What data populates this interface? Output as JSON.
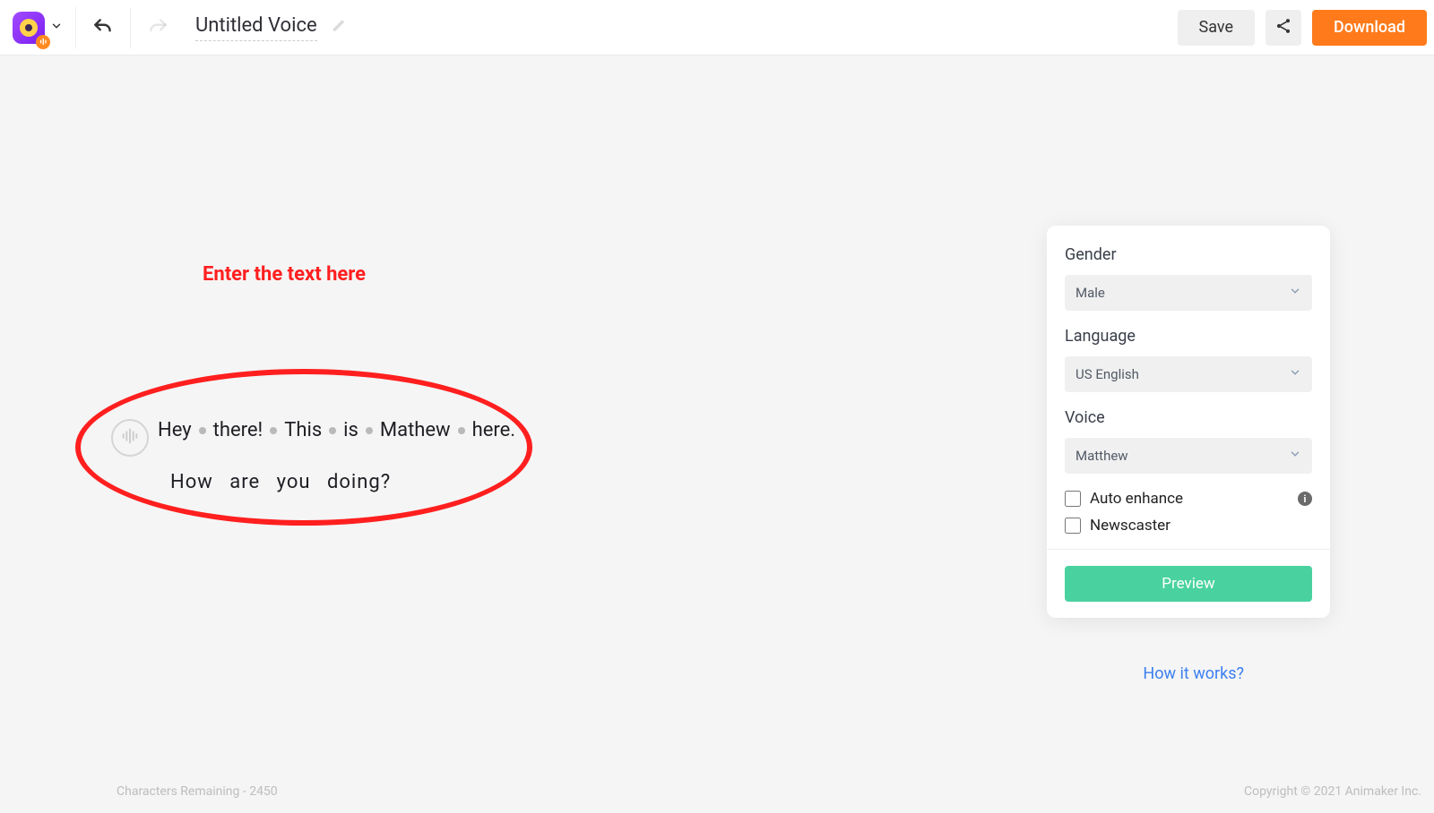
{
  "header": {
    "title": "Untitled Voice",
    "save_label": "Save",
    "download_label": "Download"
  },
  "annotation": {
    "label": "Enter the text here"
  },
  "editor": {
    "line1_tokens": [
      "Hey",
      "there!",
      "This",
      "is",
      "Mathew",
      "here."
    ],
    "line2": "How  are  you  doing?"
  },
  "panel": {
    "gender_label": "Gender",
    "gender_value": "Male",
    "language_label": "Language",
    "language_value": "US English",
    "voice_label": "Voice",
    "voice_value": "Matthew",
    "auto_enhance_label": "Auto enhance",
    "newscaster_label": "Newscaster",
    "preview_label": "Preview"
  },
  "how_it_works": "How it works?",
  "footer": {
    "chars_remaining_label": "Characters Remaining - 2450",
    "copyright": "Copyright © 2021 Animaker Inc."
  }
}
